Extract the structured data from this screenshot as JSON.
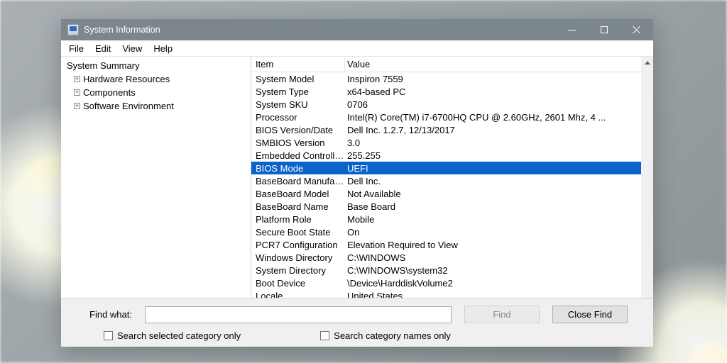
{
  "window": {
    "title": "System Information"
  },
  "menu": {
    "file": "File",
    "edit": "Edit",
    "view": "View",
    "help": "Help"
  },
  "tree": {
    "root": "System Summary",
    "items": [
      "Hardware Resources",
      "Components",
      "Software Environment"
    ]
  },
  "columns": {
    "item": "Item",
    "value": "Value"
  },
  "rows": [
    {
      "item": "System Model",
      "value": "Inspiron 7559"
    },
    {
      "item": "System Type",
      "value": "x64-based PC"
    },
    {
      "item": "System SKU",
      "value": "0706"
    },
    {
      "item": "Processor",
      "value": "Intel(R) Core(TM) i7-6700HQ CPU @ 2.60GHz, 2601 Mhz, 4 ..."
    },
    {
      "item": "BIOS Version/Date",
      "value": "Dell Inc. 1.2.7, 12/13/2017"
    },
    {
      "item": "SMBIOS Version",
      "value": "3.0"
    },
    {
      "item": "Embedded Controller V...",
      "value": "255.255"
    },
    {
      "item": "BIOS Mode",
      "value": "UEFI",
      "selected": true
    },
    {
      "item": "BaseBoard Manufacturer",
      "value": "Dell Inc."
    },
    {
      "item": "BaseBoard Model",
      "value": "Not Available"
    },
    {
      "item": "BaseBoard Name",
      "value": "Base Board"
    },
    {
      "item": "Platform Role",
      "value": "Mobile"
    },
    {
      "item": "Secure Boot State",
      "value": "On"
    },
    {
      "item": "PCR7 Configuration",
      "value": "Elevation Required to View"
    },
    {
      "item": "Windows Directory",
      "value": "C:\\WINDOWS"
    },
    {
      "item": "System Directory",
      "value": "C:\\WINDOWS\\system32"
    },
    {
      "item": "Boot Device",
      "value": "\\Device\\HarddiskVolume2"
    },
    {
      "item": "Locale",
      "value": "United States"
    }
  ],
  "footer": {
    "find_label": "Find what:",
    "find_value": "",
    "find_btn": "Find",
    "close_find_btn": "Close Find",
    "check1": "Search selected category only",
    "check2": "Search category names only"
  }
}
